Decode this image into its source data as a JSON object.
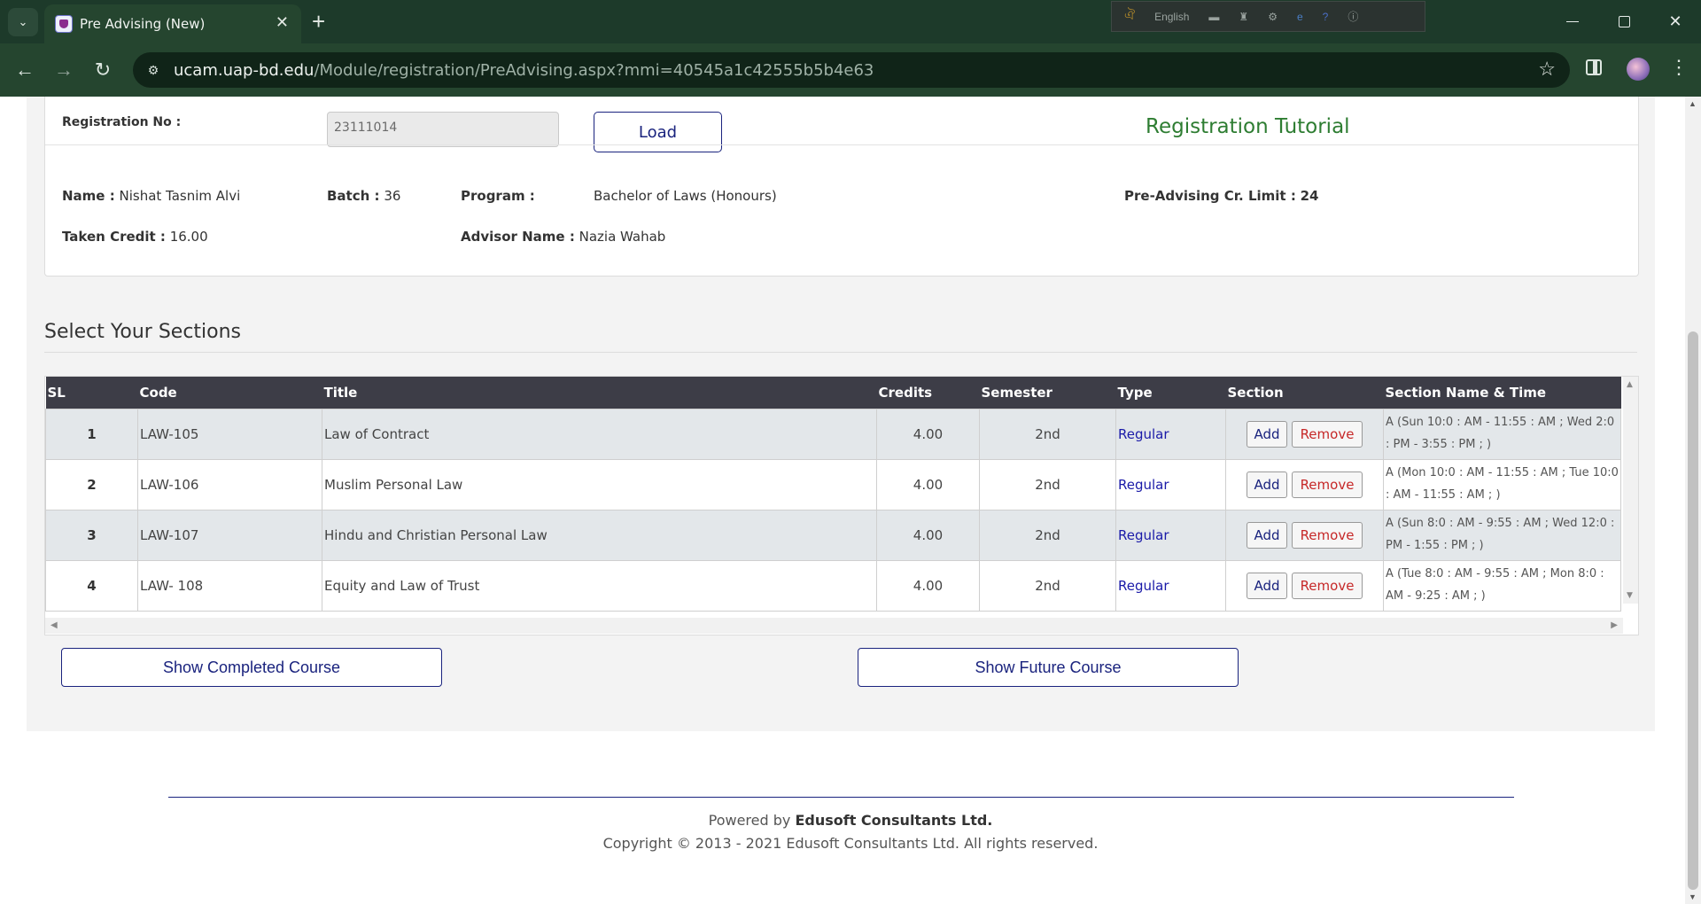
{
  "browser": {
    "tab_title": "Pre Advising (New)",
    "url_domain": "ucam.uap-bd.edu",
    "url_path": "/Module/registration/PreAdvising.aspx?mmi=40545a1c42555b5b4e63",
    "lang_label": "English"
  },
  "header": {
    "regno_label": "Registration No :",
    "regno_value": "23111014",
    "load_label": "Load",
    "tutorial_label": "Registration Tutorial"
  },
  "student": {
    "name_label": "Name :",
    "name": "Nishat Tasnim Alvi",
    "batch_label": "Batch :",
    "batch": "36",
    "program_label": "Program :",
    "program": "Bachelor of Laws (Honours)",
    "credit_limit_label": "Pre-Advising Cr. Limit :",
    "credit_limit": "24",
    "taken_label": "Taken Credit :",
    "taken": "16.00",
    "advisor_label": "Advisor Name :",
    "advisor": "Nazia Wahab"
  },
  "sections": {
    "heading": "Select Your Sections",
    "columns": [
      "SL",
      "Code",
      "Title",
      "Credits",
      "Semester",
      "Type",
      "Section",
      "Section Name & Time"
    ],
    "add_label": "Add",
    "remove_label": "Remove",
    "rows": [
      {
        "sl": "1",
        "code": "LAW-105",
        "title": "Law of Contract",
        "credits": "4.00",
        "semester": "2nd",
        "type": "Regular",
        "schedule": "A (Sun 10:0 : AM - 11:55 : AM ; Wed 2:0 : PM - 3:55 : PM ; )"
      },
      {
        "sl": "2",
        "code": "LAW-106",
        "title": "Muslim Personal Law",
        "credits": "4.00",
        "semester": "2nd",
        "type": "Regular",
        "schedule": "A (Mon 10:0 : AM - 11:55 : AM ; Tue 10:0 : AM - 11:55 : AM ; )"
      },
      {
        "sl": "3",
        "code": "LAW-107",
        "title": "Hindu and Christian Personal Law",
        "credits": "4.00",
        "semester": "2nd",
        "type": "Regular",
        "schedule": "A (Sun 8:0 : AM - 9:55 : AM ; Wed 12:0 : PM - 1:55 : PM ; )"
      },
      {
        "sl": "4",
        "code": "LAW- 108",
        "title": "Equity and Law of Trust",
        "credits": "4.00",
        "semester": "2nd",
        "type": "Regular",
        "schedule": "A (Tue 8:0 : AM - 9:55 : AM ; Mon 8:0 : AM - 9:25 : AM ; )"
      }
    ]
  },
  "actions": {
    "completed_label": "Show Completed Course",
    "future_label": "Show Future Course"
  },
  "footer": {
    "powered_prefix": "Powered by",
    "powered_company": "Edusoft Consultants Ltd.",
    "copyright": "Copyright © 2013 - 2021 Edusoft Consultants Ltd. All rights reserved."
  }
}
